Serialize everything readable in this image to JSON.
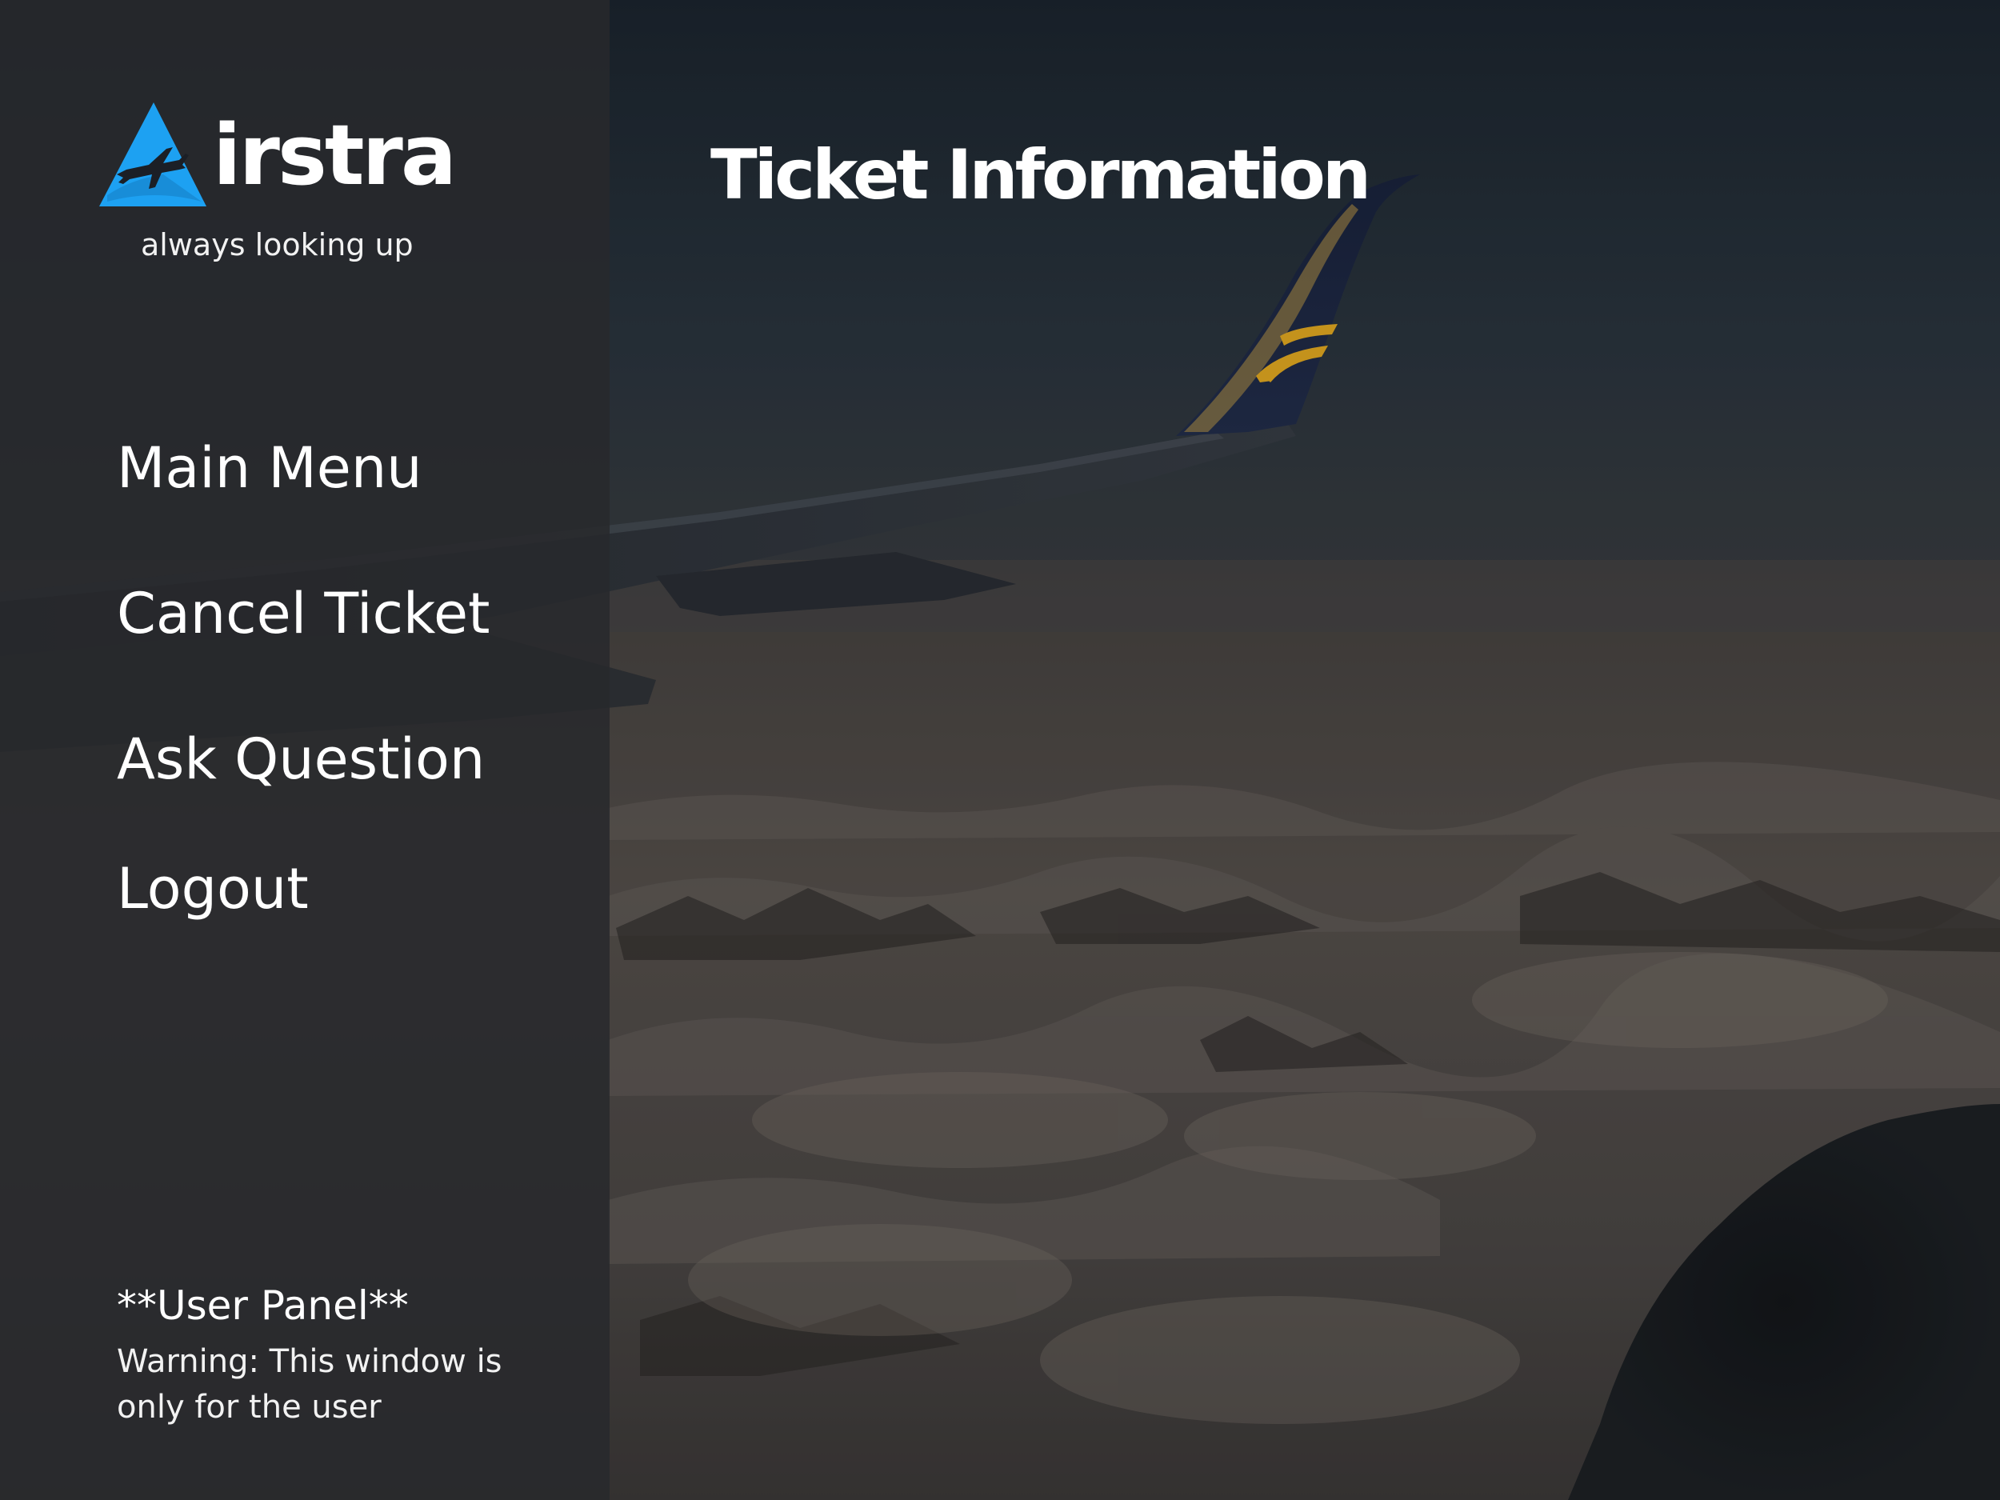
{
  "brand": {
    "name_suffix": "irstra",
    "tagline": "always looking up",
    "accent_color": "#1da1f2",
    "logo_icon": "airplane-triangle-icon"
  },
  "header": {
    "title": "Ticket Information"
  },
  "sidebar": {
    "items": [
      {
        "label": "Main Menu"
      },
      {
        "label": "Cancel Ticket"
      },
      {
        "label": "Ask Question"
      },
      {
        "label": "Logout"
      }
    ],
    "panel_title": "**User Panel**",
    "panel_warning": "Warning: This window is only for the user"
  },
  "background": {
    "scene": "airplane-wing-over-snowy-mountains"
  }
}
